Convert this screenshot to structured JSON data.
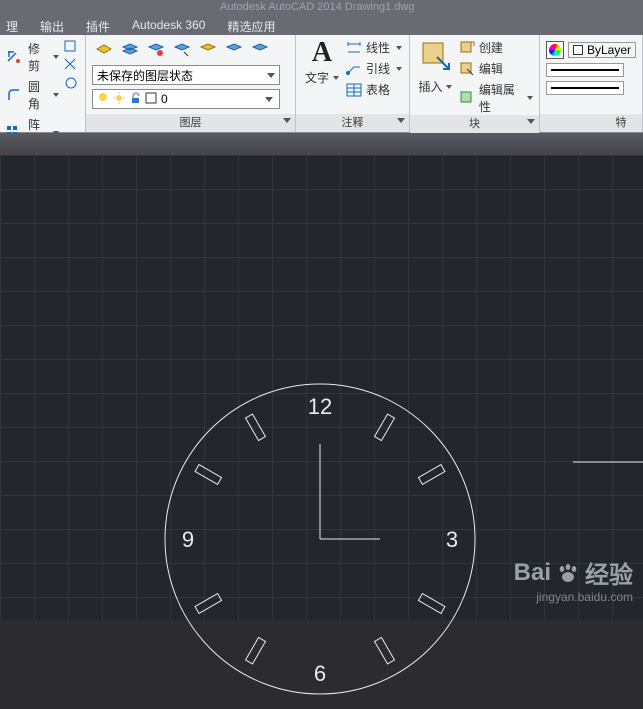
{
  "title": "Autodesk AutoCAD 2014    Drawing1.dwg",
  "menu": {
    "m1": "输出",
    "m2": "插件",
    "m3": "Autodesk 360",
    "m4": "精选应用"
  },
  "dangling": "理",
  "modify": {
    "trim": "修剪",
    "fillet": "圆角",
    "array": "阵列"
  },
  "layers": {
    "title": "图层",
    "state": "未保存的图层状态",
    "zero": "0"
  },
  "anno": {
    "title": "注释",
    "text": "文字",
    "linear": "线性",
    "leader": "引线",
    "table": "表格"
  },
  "block": {
    "title": "块",
    "insert": "插入",
    "create": "创建",
    "edit": "编辑",
    "editattr": "编辑属性"
  },
  "props": {
    "title": "特",
    "bylayer": "ByLayer"
  },
  "clock": {
    "n12": "12",
    "n3": "3",
    "n6": "6",
    "n9": "9"
  },
  "watermark": {
    "big1": "Bai",
    "big2": "经验",
    "small": "jingyan.baidu.com"
  }
}
